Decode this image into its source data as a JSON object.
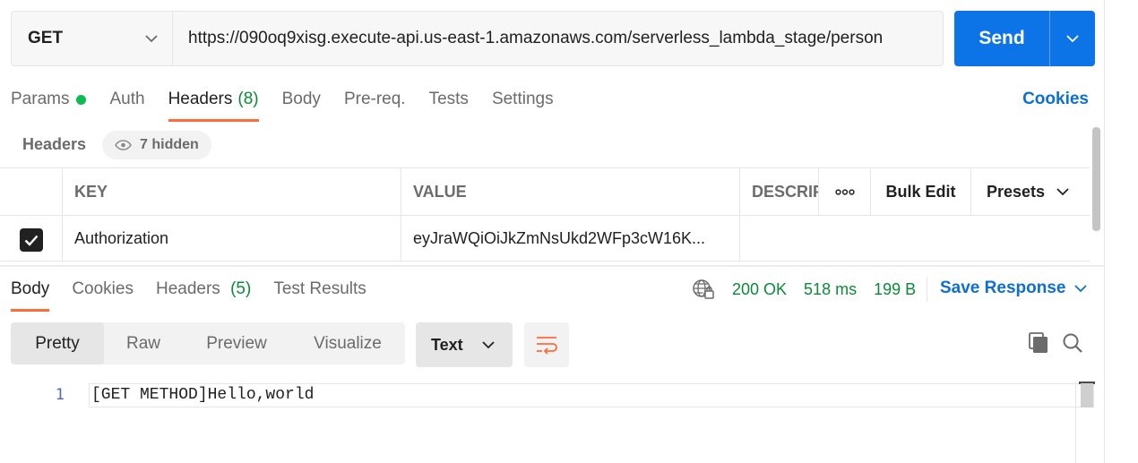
{
  "request": {
    "method": "GET",
    "url": "https://090oq9xisg.execute-api.us-east-1.amazonaws.com/serverless_lambda_stage/person",
    "send_label": "Send"
  },
  "req_tabs": {
    "params": "Params",
    "auth": "Auth",
    "headers": "Headers",
    "headers_count": "(8)",
    "body": "Body",
    "prereq": "Pre-req.",
    "tests": "Tests",
    "settings": "Settings"
  },
  "cookies_link": "Cookies",
  "headers_section": {
    "label": "Headers",
    "hidden_label": "7 hidden"
  },
  "table": {
    "columns": {
      "key": "KEY",
      "value": "VALUE",
      "description": "DESCRIPTION",
      "bulk_edit": "Bulk Edit",
      "presets": "Presets"
    },
    "rows": [
      {
        "checked": true,
        "key": "Authorization",
        "value": "eyJraWQiOiJkZmNsUkd2WFp3cW16K..."
      }
    ]
  },
  "response": {
    "tabs": {
      "body": "Body",
      "cookies": "Cookies",
      "headers": "Headers",
      "headers_count": "(5)",
      "test_results": "Test Results"
    },
    "status": "200 OK",
    "time": "518 ms",
    "size": "199 B",
    "save_label": "Save Response"
  },
  "view": {
    "modes": [
      "Pretty",
      "Raw",
      "Preview",
      "Visualize"
    ],
    "active_mode": "Pretty",
    "format": "Text"
  },
  "editor": {
    "lines": [
      {
        "no": "1",
        "text": "[GET METHOD]Hello,world"
      }
    ]
  },
  "colors": {
    "accent": "#ff6c37",
    "send": "#0d74e7",
    "link": "#0d6fd6",
    "success": "#0a8a37"
  }
}
